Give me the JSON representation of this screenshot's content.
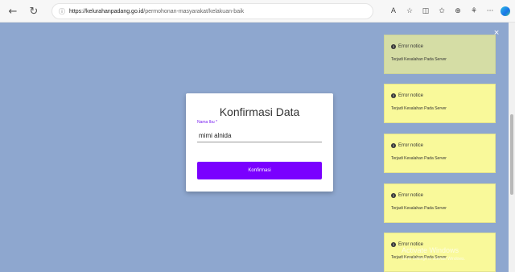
{
  "browser": {
    "url_host": "https://kelurahanpadang.go.id",
    "url_path": "/permohonan-masyarakat/kelakuan-baik",
    "icons": {
      "back": "←",
      "refresh": "↻",
      "lock": "ⓘ",
      "read_aloud": "A",
      "favorite": "☆",
      "split": "◫",
      "favorites": "✩",
      "collections": "⊕",
      "extensions": "⚘",
      "more": "···"
    }
  },
  "dialog": {
    "title": "Konfirmasi Data",
    "field_label": "Nama Ibu *",
    "field_value": "mimi alnida",
    "button_label": "Konfirmasi"
  },
  "notices": [
    {
      "title": "Error notice",
      "message": "Terjadi Kesalahan Pada Server"
    },
    {
      "title": "Error notice",
      "message": "Terjadi Kesalahan Pada Server"
    },
    {
      "title": "Error notice",
      "message": "Terjadi Kesalahan Pada Server"
    },
    {
      "title": "Error notice",
      "message": "Terjadi Kesalahan Pada Server"
    },
    {
      "title": "Error notice",
      "message": "Terjadi Kesalahan Pada Server"
    }
  ],
  "notice_icon": "!",
  "close_symbol": "×",
  "watermark": {
    "title": "Activate Windows",
    "subtitle": "Go to Settings to activate Windows."
  },
  "colors": {
    "page_background": "#8ea7cf",
    "accent": "#7a00ff",
    "notice": "#f9f99a",
    "notice_faded": "#d5dda5"
  }
}
